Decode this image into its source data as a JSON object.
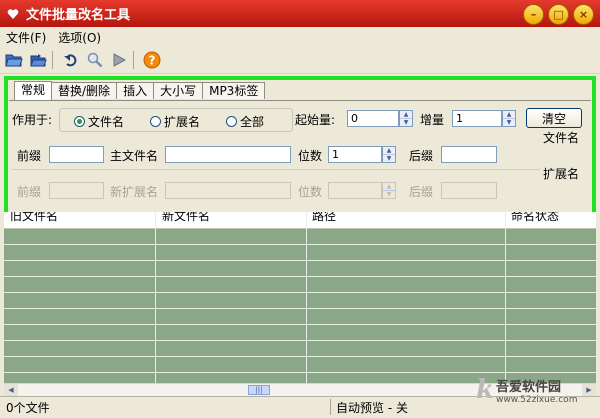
{
  "window": {
    "title": "文件批量改名工具"
  },
  "menu": [
    {
      "id": "file",
      "label": "文件(F)"
    },
    {
      "id": "options",
      "label": "选项(O)"
    }
  ],
  "toolbar": {
    "icons": [
      "open-folder-icon",
      "open-files-icon",
      "undo-icon",
      "search-icon",
      "run-icon",
      "help-icon"
    ]
  },
  "tabs": [
    {
      "label": "常规",
      "active": true
    },
    {
      "label": "替换/删除",
      "active": false
    },
    {
      "label": "插入",
      "active": false
    },
    {
      "label": "大小写",
      "active": false
    },
    {
      "label": "MP3标签",
      "active": false
    }
  ],
  "general": {
    "apply_label": "作用于:",
    "radios": [
      {
        "label": "文件名",
        "checked": true
      },
      {
        "label": "扩展名",
        "checked": false
      },
      {
        "label": "全部",
        "checked": false
      }
    ],
    "start_label": "起始量:",
    "start_value": "0",
    "inc_label": "增量",
    "inc_value": "1",
    "clear_label": "清空",
    "filename_section": "文件名",
    "ext_section": "扩展名",
    "prefix_label": "前缀",
    "prefix_value": "",
    "mainname_label": "主文件名",
    "mainname_value": "",
    "digits_label": "位数",
    "digits_value": "1",
    "suffix_label": "后缀",
    "suffix_value": "",
    "ext_prefix_label": "前缀",
    "newext_label": "新扩展名",
    "ext_digits_label": "位数",
    "ext_suffix_label": "后缀"
  },
  "list": {
    "columns": [
      "旧文件名",
      "新文件名",
      "路径",
      "命名状态"
    ]
  },
  "status": {
    "count": "0个文件",
    "preview": "自动预览 - 关"
  },
  "watermark": {
    "big": "吾爱软件园",
    "small": "www.52zixue.com"
  },
  "colors": {
    "highlight_border": "#22e022",
    "title_bar": "#c81e14",
    "list_bg": "#8aa887"
  }
}
